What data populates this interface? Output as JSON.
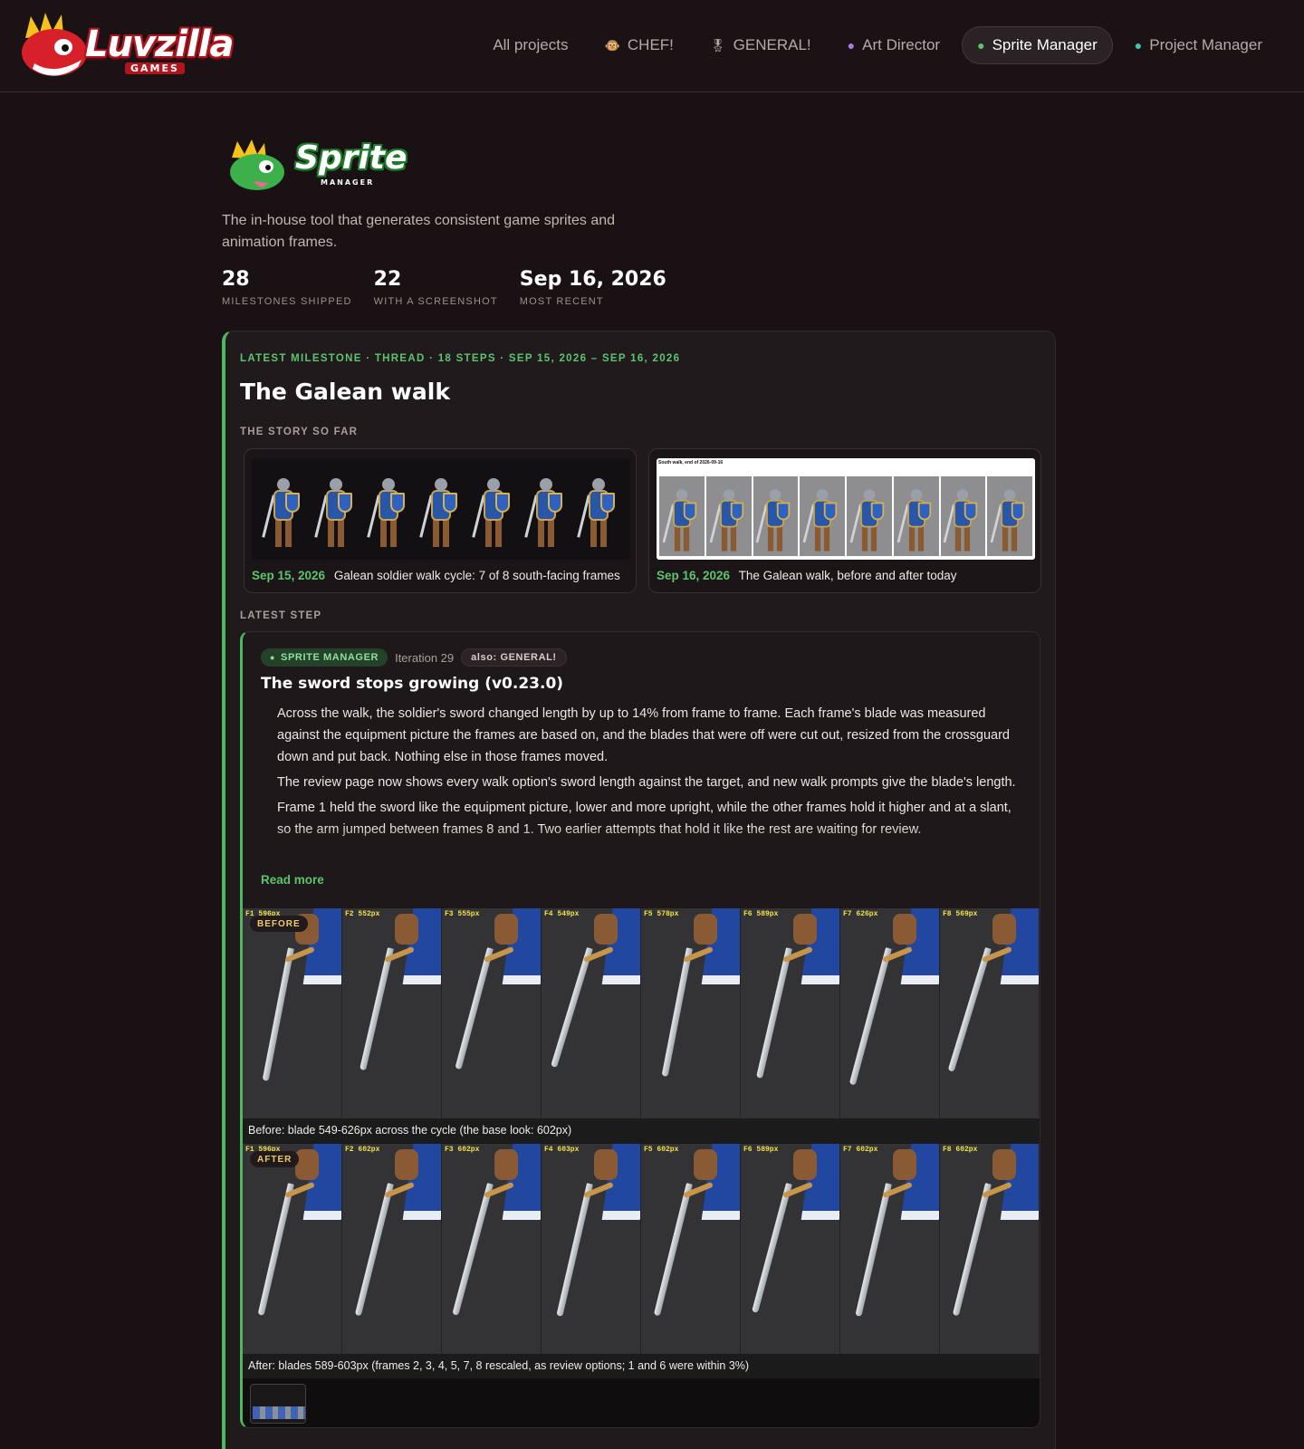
{
  "brand": {
    "name": "Luvzilla",
    "sub": "GAMES"
  },
  "nav": [
    {
      "label": "All projects",
      "icon": ""
    },
    {
      "label": "CHEF!",
      "icon": "chef-mascot-icon"
    },
    {
      "label": "GENERAL!",
      "icon": "general-mascot-icon"
    },
    {
      "label": "Art Director",
      "icon": "art-director-mascot-icon"
    },
    {
      "label": "Sprite Manager",
      "icon": "sprite-manager-mascot-icon",
      "active": true
    },
    {
      "label": "Project Manager",
      "icon": "project-manager-mascot-icon"
    }
  ],
  "hero": {
    "logo_word": "Sprite",
    "logo_sub": "MANAGER",
    "tagline": "The in-house tool that generates consistent game sprites and animation frames.",
    "stats": [
      {
        "value": "28",
        "label": "MILESTONES SHIPPED"
      },
      {
        "value": "22",
        "label": "WITH A SCREENSHOT"
      },
      {
        "value": "Sep 16, 2026",
        "label": "MOST RECENT"
      }
    ]
  },
  "milestone": {
    "eyebrow": "LATEST MILESTONE · THREAD · 18 STEPS · SEP 15, 2026 – SEP 16, 2026",
    "title": "The Galean walk",
    "story_label": "THE STORY SO FAR",
    "story": [
      {
        "date": "Sep 15, 2026",
        "caption": "Galean soldier walk cycle: 7 of 8 south-facing frames"
      },
      {
        "date": "Sep 16, 2026",
        "caption": "The Galean walk, before and after today",
        "strip_title": "South walk, end of 2026-09-16"
      }
    ],
    "latest_label": "LATEST STEP",
    "step": {
      "pill": "SPRITE MANAGER",
      "iteration": "Iteration 29",
      "also": "also: GENERAL!",
      "title": "The sword stops growing (v0.23.0)",
      "bullets": [
        "Across the walk, the soldier's sword changed length by up to 14% from frame to frame. Each frame's blade was measured against the equipment picture the frames are based on, and the blades that were off were cut out, resized from the crossguard down and put back. Nothing else in those frames moved.",
        "The review page now shows every walk option's sword length against the target, and new walk prompts give the blade's length.",
        "Frame 1 held the sword like the equipment picture, lower and more upright, while the other frames hold it higher and at a slant, so the arm jumped between frames 8 and 1. Two earlier attempts that hold it like the rest are waiting for review."
      ],
      "read_more": "Read more",
      "before": {
        "badge": "BEFORE",
        "frames": [
          "F1 596px",
          "F2 552px",
          "F3 555px",
          "F4 549px",
          "F5 578px",
          "F6 589px",
          "F7 626px",
          "F8 569px"
        ],
        "caption": "Before: blade 549-626px across the cycle (the base look: 602px)"
      },
      "after": {
        "badge": "AFTER",
        "frames": [
          "F1 596px",
          "F2 602px",
          "F3 602px",
          "F4 603px",
          "F5 602px",
          "F6 589px",
          "F7 602px",
          "F8 602px"
        ],
        "caption": "After: blades 589-603px (frames 2, 3, 4, 5, 7, 8 rescaled, as review options; 1 and 6 were within 3%)"
      }
    }
  }
}
